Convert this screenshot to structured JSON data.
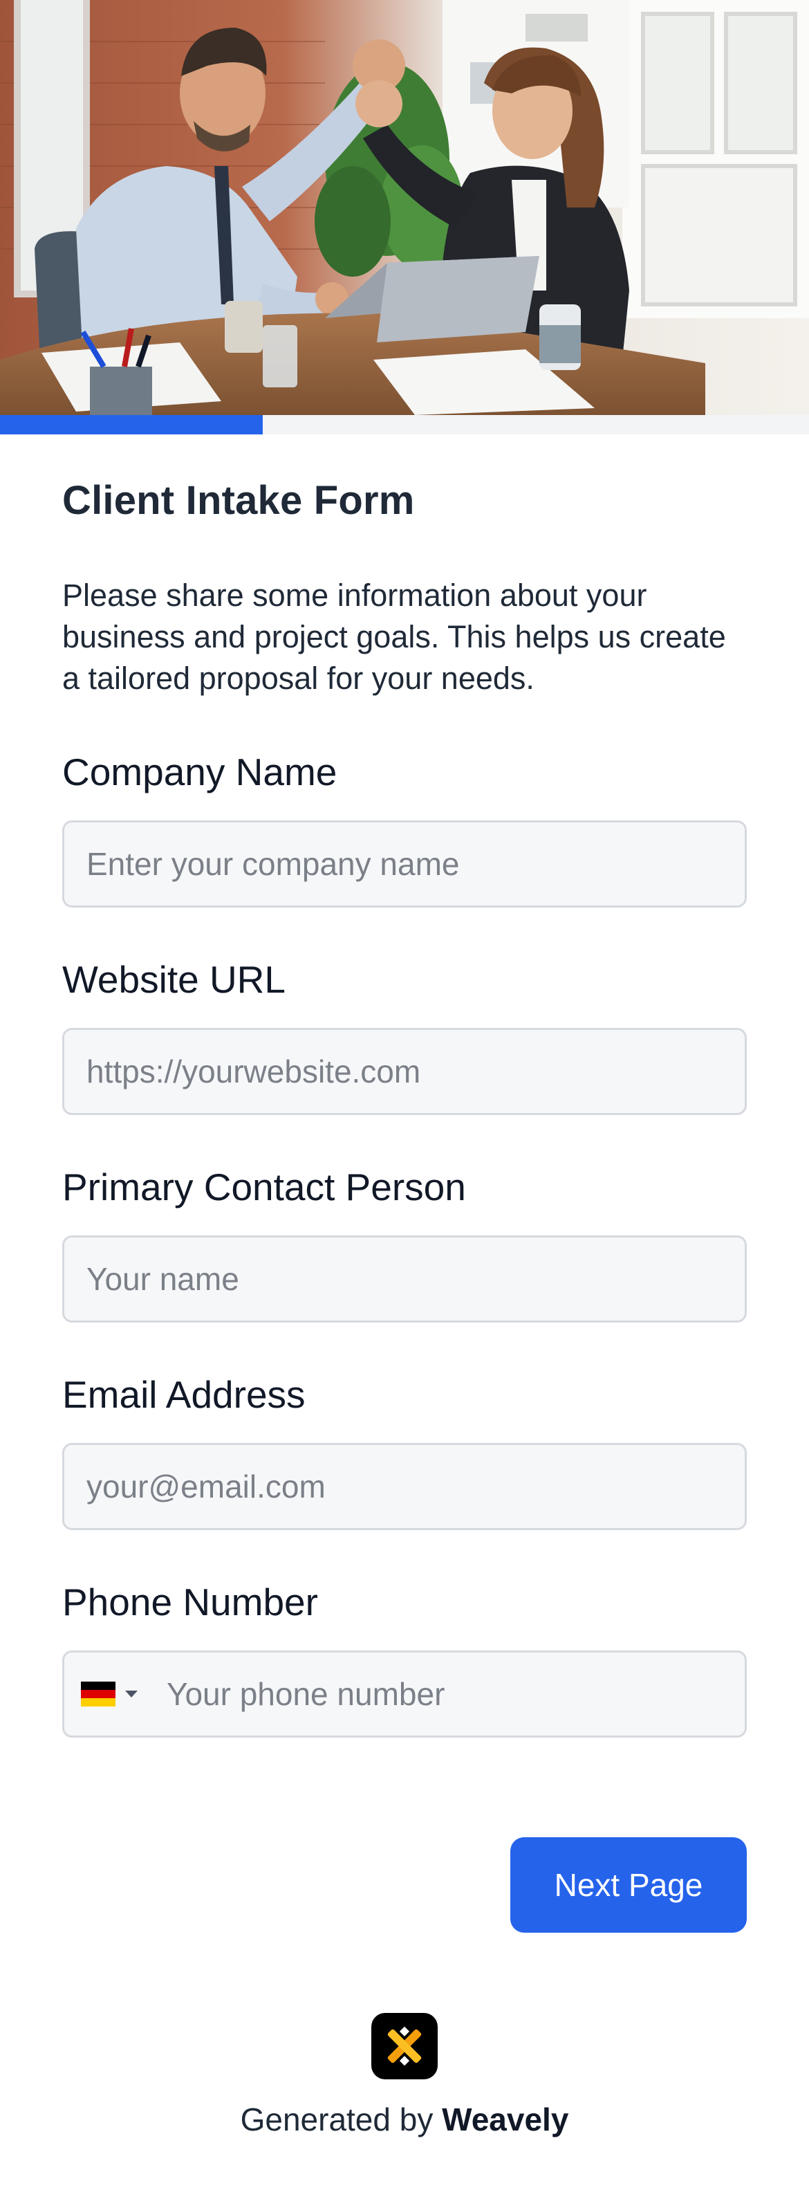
{
  "hero": {
    "image": "office-high-five-photo"
  },
  "progress": {
    "fraction": 0.325,
    "color": "#2563eb"
  },
  "form": {
    "title": "Client Intake Form",
    "intro": "Please share some information about your business and project goals. This helps us create a tailored proposal for your needs.",
    "fields": {
      "company": {
        "label": "Company Name",
        "placeholder": "Enter your company name",
        "value": ""
      },
      "website": {
        "label": "Website URL",
        "placeholder": "https://yourwebsite.com",
        "value": ""
      },
      "contact": {
        "label": "Primary Contact Person",
        "placeholder": "Your name",
        "value": ""
      },
      "email": {
        "label": "Email Address",
        "placeholder": "your@email.com",
        "value": ""
      },
      "phone": {
        "label": "Phone Number",
        "placeholder": "Your phone number",
        "value": "",
        "country_flag": "germany-flag-icon"
      }
    },
    "next_button_label": "Next Page"
  },
  "footer": {
    "generated_prefix": "Generated by ",
    "brand": "Weavely",
    "logo_icon": "weavely-logo-icon"
  },
  "colors": {
    "accent": "#2563eb",
    "input_bg": "#f6f7f9",
    "input_border": "#d6d9de",
    "text": "#1f2937"
  }
}
